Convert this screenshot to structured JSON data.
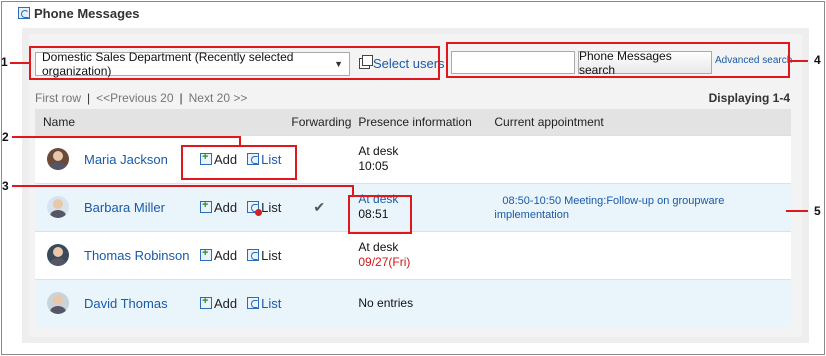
{
  "title": "Phone Messages",
  "org_select": {
    "value": "Domestic Sales Department (Recently selected organization)"
  },
  "select_users_label": "Select users",
  "search": {
    "value": "",
    "button_label": "Phone Messages search",
    "advanced_label": "Advanced search"
  },
  "pager": {
    "first": "First row",
    "prev": "<<Previous 20",
    "next": "Next 20 >>",
    "sep": "|",
    "displaying": "Displaying 1-4"
  },
  "columns": {
    "name": "Name",
    "forwarding": "Forwarding",
    "presence": "Presence information",
    "appointment": "Current appointment"
  },
  "rows": [
    {
      "name": "Maria Jackson",
      "add": "Add",
      "list": "List",
      "forwarding": "",
      "presence_1": "At desk",
      "presence_2": "10:05",
      "appointment": ""
    },
    {
      "name": "Barbara Miller",
      "add": "Add",
      "list": "List",
      "forwarding": "✔",
      "presence_1": "At desk",
      "presence_2": "08:51",
      "appointment": "08:50-10:50 Meeting:Follow-up on groupware implementation"
    },
    {
      "name": "Thomas Robinson",
      "add": "Add",
      "list": "List",
      "forwarding": "",
      "presence_1": "At desk",
      "presence_2": "09/27(Fri)",
      "appointment": ""
    },
    {
      "name": "David Thomas",
      "add": "Add",
      "list": "List",
      "forwarding": "",
      "presence_1": "No entries",
      "presence_2": "",
      "appointment": ""
    }
  ],
  "callouts": [
    "1",
    "2",
    "3",
    "4",
    "5"
  ],
  "colors": {
    "link": "#1a5aa6",
    "callout": "#e0181e",
    "alert": "#d01818"
  }
}
